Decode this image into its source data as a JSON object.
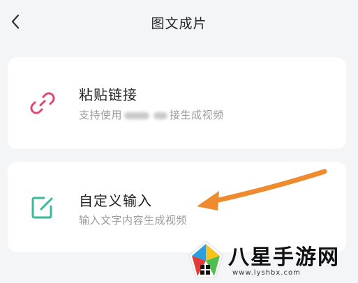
{
  "header": {
    "title": "图文成片",
    "back_icon": "chevron-left-icon"
  },
  "cards": [
    {
      "title": "粘贴链接",
      "subtitle_prefix": "支持使用",
      "subtitle_suffix": "接生成视频",
      "icon": "link-icon",
      "icon_color": "#e0476e"
    },
    {
      "title": "自定义输入",
      "subtitle": "输入文字内容生成视频",
      "icon": "edit-icon",
      "icon_color": "#3bb89a"
    }
  ],
  "annotation": {
    "arrow_color": "#f08a2e"
  },
  "watermark": {
    "text": "八星手游网",
    "url": "www.lyshbx.com"
  }
}
